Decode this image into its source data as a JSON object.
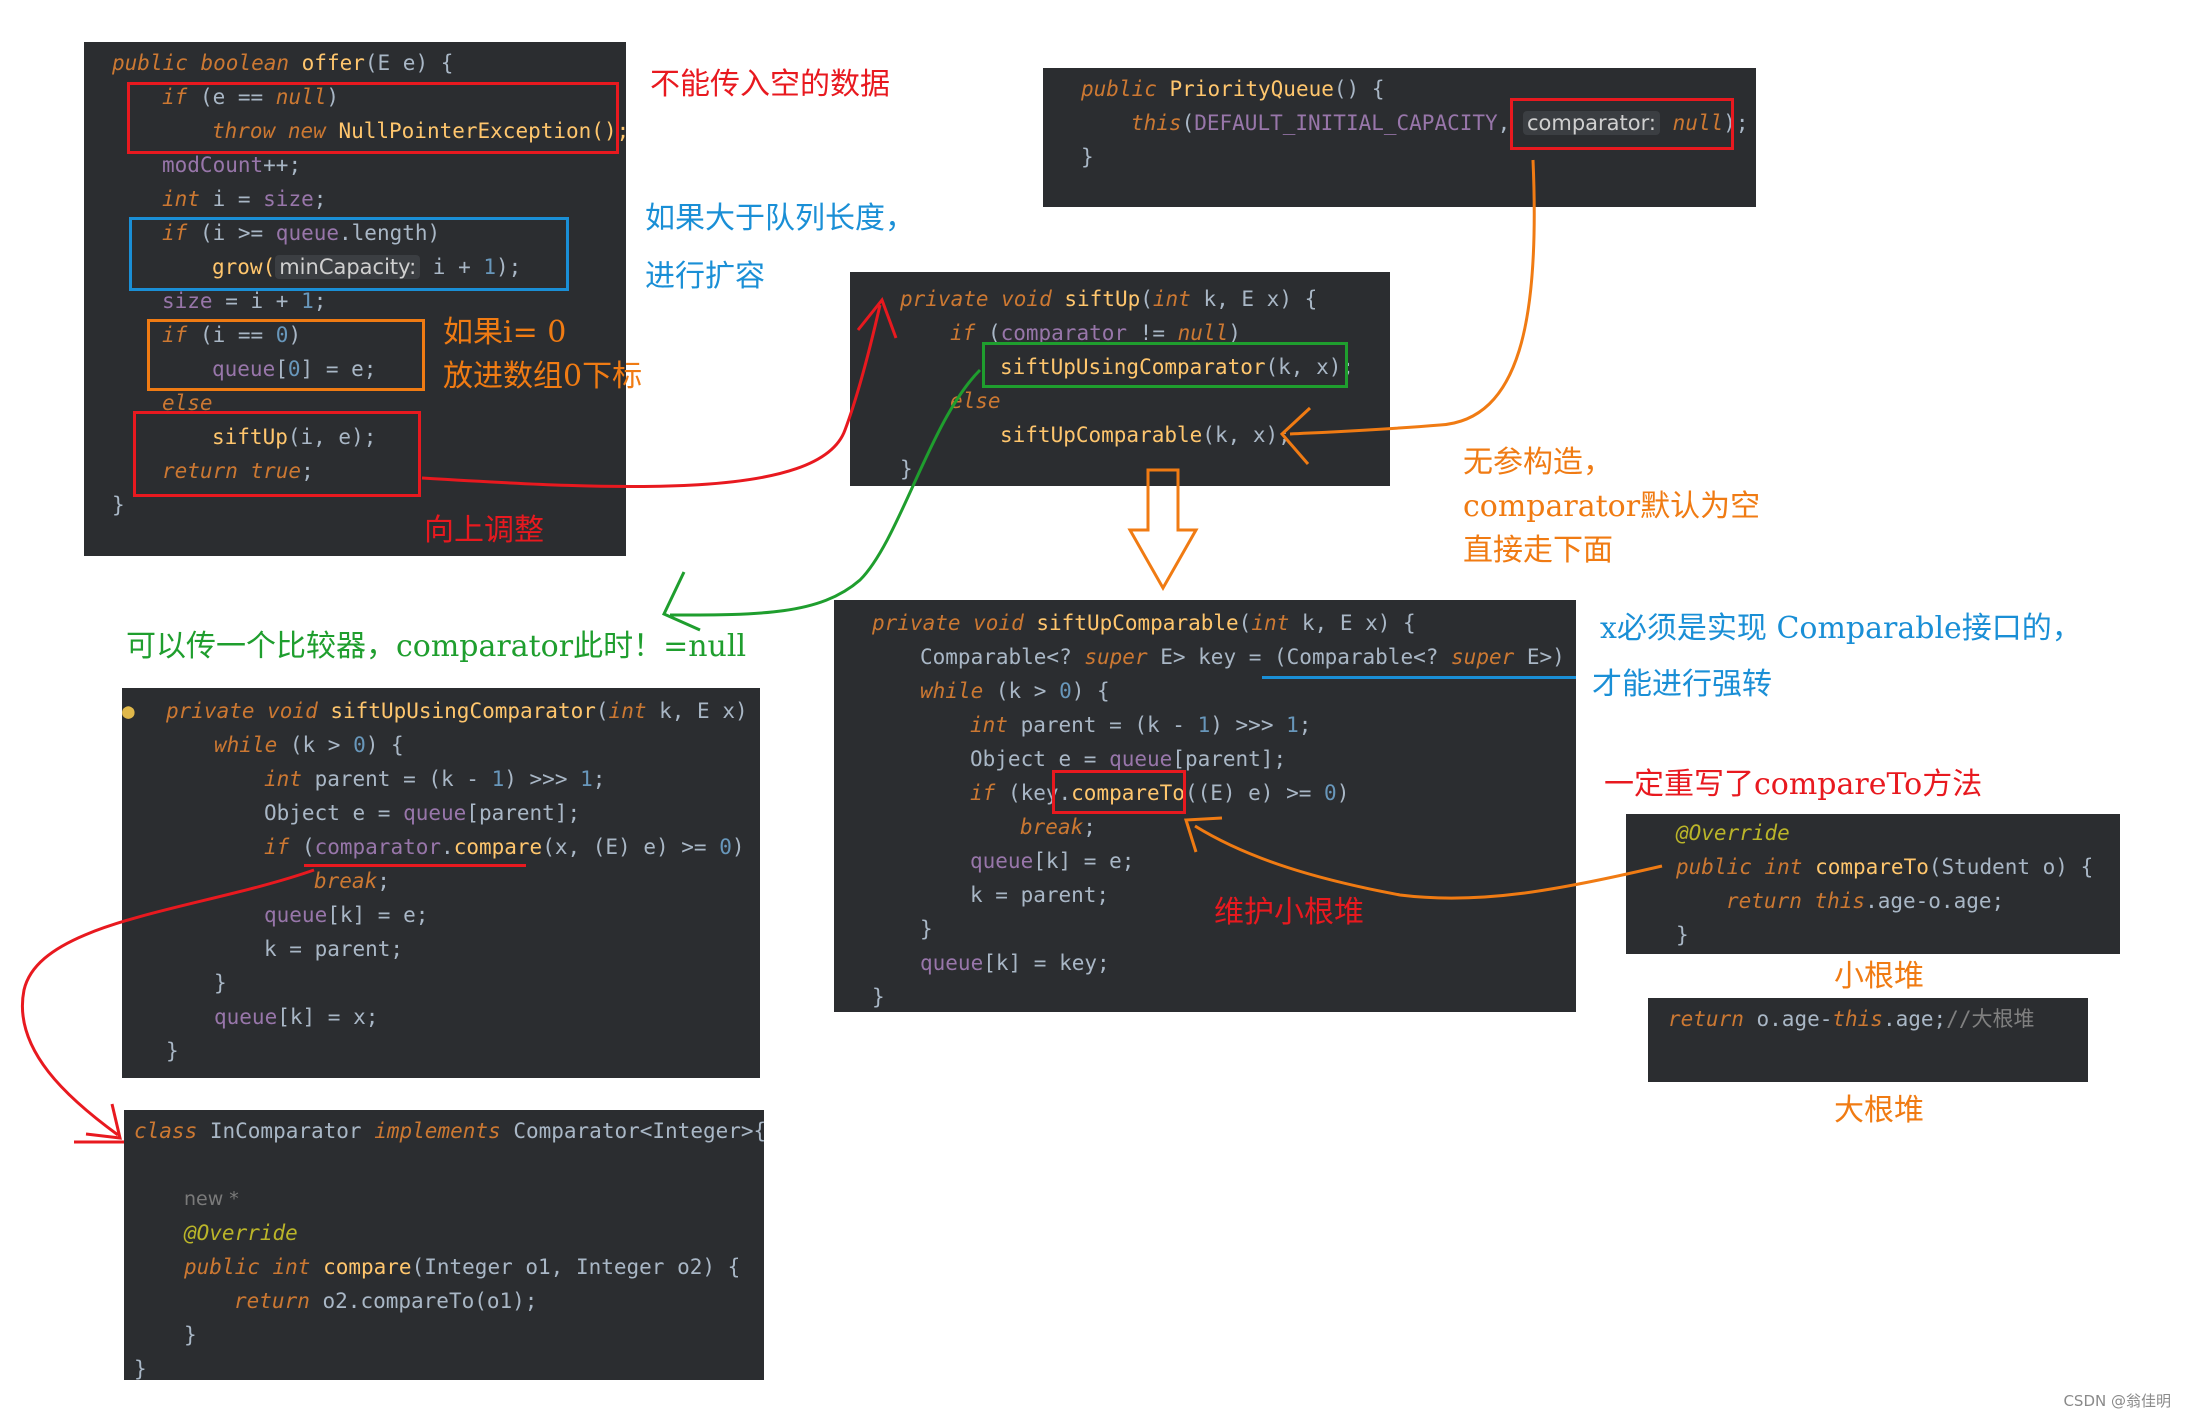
{
  "colors": {
    "panel_bg": "#2b2d30",
    "red": "#e8191f",
    "blue": "#1a8fd6",
    "orange": "#f07b13",
    "green": "#1f9e2e"
  },
  "offer_code": {
    "l1": {
      "a": "public boolean ",
      "b": "offer",
      "c": "(E e) {"
    },
    "l2": {
      "a": "if ",
      "b": "(e == ",
      "c": "null",
      "d": ")"
    },
    "l3": {
      "a": "throw new ",
      "b": "NullPointerException();"
    },
    "l4": {
      "a": "modCount",
      "b": "++;"
    },
    "l5": {
      "a": "int ",
      "b": "i = ",
      "c": "size",
      "d": ";"
    },
    "l6": {
      "a": "if ",
      "b": "(i >= ",
      "c": "queue",
      "d": ".length)"
    },
    "l7": {
      "a": "grow(",
      "hint": "minCapacity:",
      "b": " i + ",
      "c": "1",
      "d": ");"
    },
    "l8": {
      "a": "size",
      "b": " = i + ",
      "c": "1",
      "d": ";"
    },
    "l9": {
      "a": "if ",
      "b": "(i == ",
      "c": "0",
      "d": ")"
    },
    "l10": {
      "a": "queue",
      "b": "[",
      "c": "0",
      "d": "] = e;"
    },
    "l11": {
      "a": "else"
    },
    "l12": {
      "a": "siftUp",
      "b": "(i, e);"
    },
    "l13": {
      "a": "return true",
      "b": ";"
    },
    "l14": {
      "a": "}"
    }
  },
  "ctor_code": {
    "l1": {
      "a": "public ",
      "b": "PriorityQueue",
      "c": "() {"
    },
    "l2": {
      "a": "this",
      "b": "(",
      "c": "DEFAULT_INITIAL_CAPACITY",
      "d": ", ",
      "hint": "comparator:",
      "e": "null",
      "f": ");"
    },
    "l3": {
      "a": "}"
    }
  },
  "siftup_code": {
    "l1": {
      "a": "private void ",
      "b": "siftUp",
      "c": "(",
      "d": "int ",
      "e": "k, E x) {"
    },
    "l2": {
      "a": "if ",
      "b": "(",
      "c": "comparator",
      "d": " != ",
      "e": "null",
      "f": ")"
    },
    "l3": {
      "a": "siftUpUsingComparator",
      "b": "(k, x);"
    },
    "l4": {
      "a": "else"
    },
    "l5": {
      "a": "siftUpComparable",
      "b": "(k, x);"
    },
    "l6": {
      "a": "}"
    }
  },
  "comparable_code": {
    "l1": {
      "a": "private void ",
      "b": "siftUpComparable",
      "c": "(",
      "d": "int ",
      "e": "k, E x) {"
    },
    "l2": {
      "a": "Comparable<? ",
      "b": "super",
      "c": " E> key = (Comparable<? ",
      "d": "super",
      "e": " E>) x;"
    },
    "l3": {
      "a": "while ",
      "b": "(k > ",
      "c": "0",
      "d": ") {"
    },
    "l4": {
      "a": "int ",
      "b": "parent = (k - ",
      "c": "1",
      "d": ") >>> ",
      "e": "1",
      "f": ";"
    },
    "l5": {
      "a": "Object e = ",
      "b": "queue",
      "c": "[parent];"
    },
    "l6": {
      "a": "if ",
      "b": "(key.",
      "c": "compareTo",
      "d": "((E) e) >= ",
      "e": "0",
      "f": ")"
    },
    "l7": {
      "a": "break",
      "b": ";"
    },
    "l8": {
      "a": "queue",
      "b": "[k] = e;"
    },
    "l9": {
      "a": "k = parent;"
    },
    "l10": {
      "a": "}"
    },
    "l11": {
      "a": "queue",
      "b": "[k] = key;"
    },
    "l12": {
      "a": "}"
    }
  },
  "comparator_code": {
    "l1": {
      "a": "private void ",
      "b": "siftUpUsingComparator",
      "c": "(",
      "d": "int ",
      "e": "k, E x) {"
    },
    "l2": {
      "a": "while ",
      "b": "(k > ",
      "c": "0",
      "d": ") {"
    },
    "l3": {
      "a": "int ",
      "b": "parent = (k - ",
      "c": "1",
      "d": ") >>> ",
      "e": "1",
      "f": ";"
    },
    "l4": {
      "a": "Object e = ",
      "b": "queue",
      "c": "[parent];"
    },
    "l5": {
      "a": "if ",
      "b": "(",
      "c": "comparator",
      "d": ".",
      "e": "compare",
      "f": "(x, (E) e) >= ",
      "g": "0",
      "h": ")"
    },
    "l6": {
      "a": "break",
      "b": ";"
    },
    "l7": {
      "a": "queue",
      "b": "[k] = e;"
    },
    "l8": {
      "a": "k = parent;"
    },
    "l9": {
      "a": "}"
    },
    "l10": {
      "a": "queue",
      "b": "[k] = x;"
    },
    "l11": {
      "a": "}"
    }
  },
  "incomparator_code": {
    "l1": {
      "a": "class ",
      "b": "InComparator ",
      "c": "implements ",
      "d": "Comparator<Integer>{"
    },
    "l2": {
      "a": "new *"
    },
    "l3": {
      "a": "@Override"
    },
    "l4": {
      "a": "public int ",
      "b": "compare",
      "c": "(Integer o1, Integer o2) {"
    },
    "l5": {
      "a": "return ",
      "b": "o2.compareTo(o1);"
    },
    "l6": {
      "a": "}"
    },
    "l7": {
      "a": "}"
    }
  },
  "compareto_code": {
    "l1": {
      "a": "@Override"
    },
    "l2": {
      "a": "public int ",
      "b": "compareTo",
      "c": "(Student o) {"
    },
    "l3": {
      "a": "return this",
      "b": ".age-o.age;"
    },
    "l4": {
      "a": "}"
    }
  },
  "maxheap_code": {
    "l1": {
      "a": "return ",
      "b": "o.age-",
      "c": "this",
      "d": ".age;",
      "e": "//大根堆"
    }
  },
  "notes": {
    "no_null": "不能传入空的数据",
    "grow1": "如果大于队列长度，",
    "grow2": "进行扩容",
    "zero1": "如果i= 0",
    "zero2": "放进数组0下标",
    "siftup": "向上调整",
    "ctor1": "无参构造，",
    "ctor2": "comparator默认为空",
    "ctor3": "直接走下面",
    "comparator": "可以传一个比较器，comparator此时！=null",
    "comparable1": "x必须是实现 Comparable接口的，",
    "comparable2": "才能进行强转",
    "override": "一定重写了compareTo方法",
    "min_heap_maint": "维护小根堆",
    "min_heap": "小根堆",
    "max_heap": "大根堆"
  },
  "watermark": "CSDN @翁佳明"
}
